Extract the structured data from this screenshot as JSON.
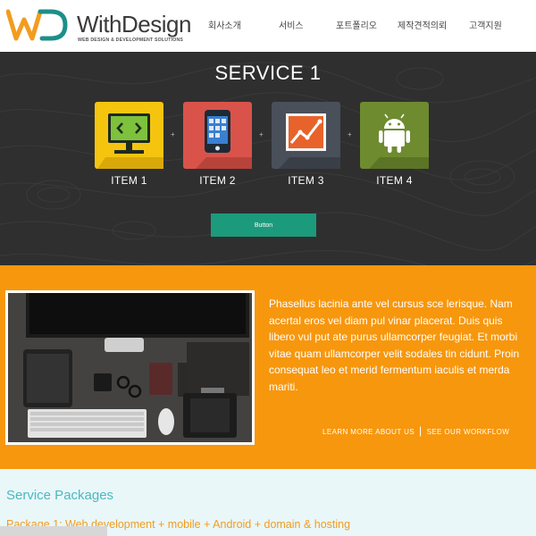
{
  "header": {
    "brand_name": "WithDesign",
    "brand_tagline": "WEB DESIGN & DEVELOPMENT SOLUTIONS",
    "nav": [
      "회사소개",
      "서비스",
      "포트폴리오",
      "제작견적의뢰",
      "고객지원"
    ]
  },
  "service": {
    "title": "SERVICE 1",
    "items": [
      {
        "label": "ITEM 1",
        "icon": "monitor-code-icon",
        "color": "#f5c40f"
      },
      {
        "label": "ITEM 2",
        "icon": "smartphone-icon",
        "color": "#d9534a"
      },
      {
        "label": "ITEM 3",
        "icon": "line-chart-icon",
        "color": "#4a505a"
      },
      {
        "label": "ITEM 4",
        "icon": "android-icon",
        "color": "#6e8b30"
      }
    ],
    "separator": "+",
    "button_label": "Button"
  },
  "feature": {
    "paragraph": "Phasellus lacinia ante vel cursus sce lerisque. Nam acertal eros vel diam pul vinar placerat. Duis quis libero vul put ate purus ullamcorper feugiat. Et morbi vitae quam ullamcorper velit sodales tin cidunt. Proin consequat leo et merid fermentum iaculis et merda mariti.",
    "link_learn_more": "LEARN MORE ABOUT US",
    "link_separator": "|",
    "link_workflow": "SEE OUR WORKFLOW"
  },
  "packages": {
    "title": "Service Packages",
    "package_1": "Package 1: Web development + mobile + Android + domain & hosting"
  },
  "colors": {
    "dark_band": "#2f2f2f",
    "accent_green": "#1c9a7c",
    "orange_band": "#f7970d",
    "packages_bg": "#eaf7f9",
    "packages_title": "#4ab9c0",
    "packages_text": "#f29c1f"
  }
}
